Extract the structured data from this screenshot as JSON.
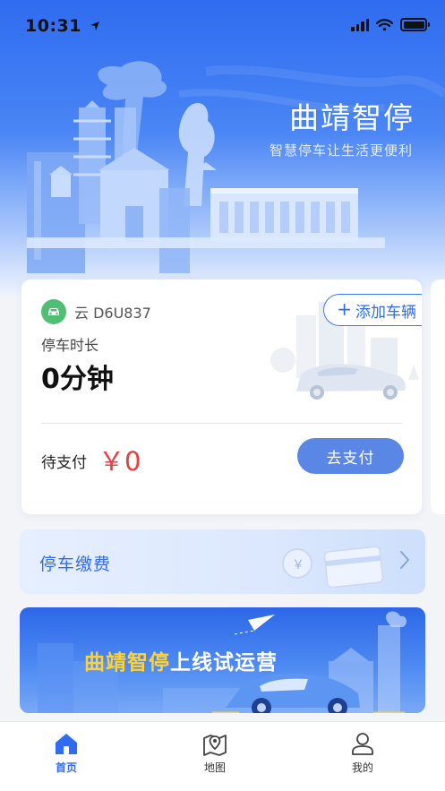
{
  "status_bar": {
    "time": "10:31"
  },
  "hero": {
    "title": "曲靖智停",
    "subtitle": "智慧停车让生活更便利"
  },
  "vehicle_card": {
    "plate": "云 D6U837",
    "add_vehicle_label": "添加车辆",
    "duration_label": "停车时长",
    "duration_value": "0分钟",
    "pay_label": "待支付",
    "pay_amount": "￥0",
    "pay_button": "去支付"
  },
  "parking_fee": {
    "label": "停车缴费"
  },
  "promo": {
    "highlight": "曲靖智停",
    "rest": "上线试运营"
  },
  "tabs": [
    {
      "label": "首页",
      "icon": "home-icon",
      "active": true
    },
    {
      "label": "地图",
      "icon": "map-icon",
      "active": false
    },
    {
      "label": "我的",
      "icon": "user-icon",
      "active": false
    }
  ],
  "colors": {
    "primary": "#2f6cf0",
    "amount": "#ef3b3b",
    "plate_badge": "#4fbf73",
    "promo_highlight": "#ffd233"
  }
}
